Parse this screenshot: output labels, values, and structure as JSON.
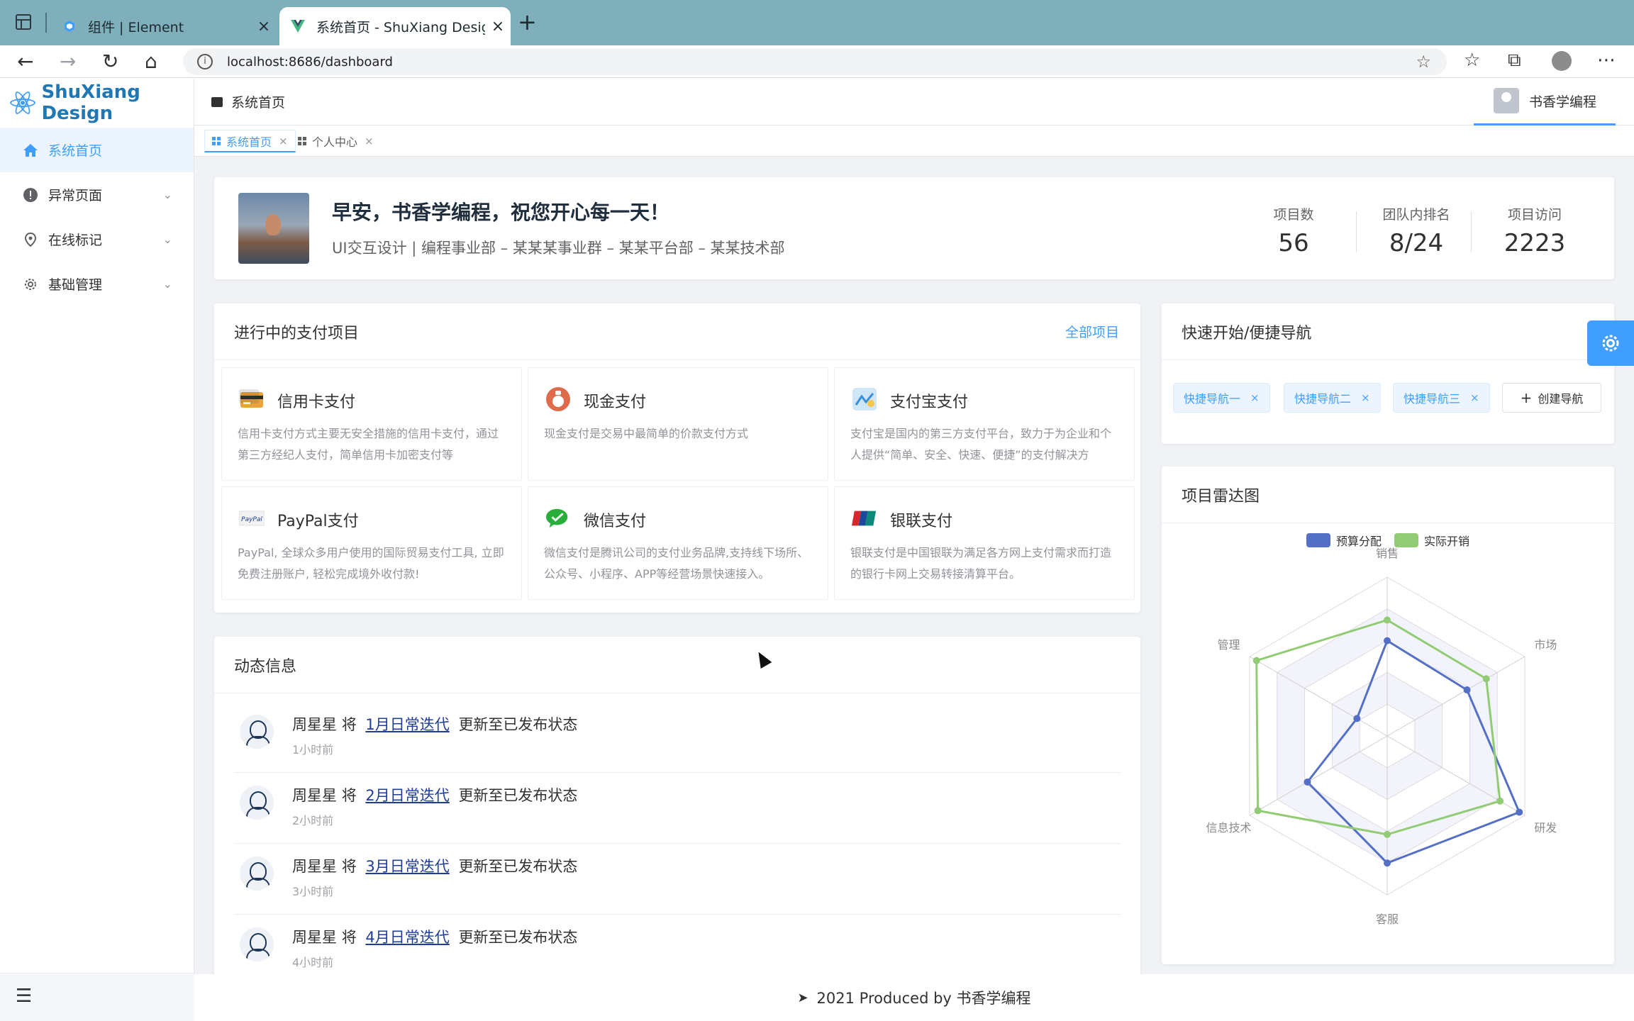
{
  "browser": {
    "tabs": [
      {
        "title": "组件 | Element",
        "icon": "element-favicon"
      },
      {
        "title": "系统首页 - ShuXiang Design",
        "icon": "vue-favicon"
      }
    ],
    "url": "localhost:8686/dashboard"
  },
  "app": {
    "logo_text": "ShuXiang Design",
    "menu": [
      {
        "label": "系统首页",
        "icon": "home-icon",
        "active": true
      },
      {
        "label": "异常页面",
        "icon": "warning-icon"
      },
      {
        "label": "在线标记",
        "icon": "location-icon"
      },
      {
        "label": "基础管理",
        "icon": "settings-icon"
      }
    ]
  },
  "header": {
    "breadcrumb": "系统首页",
    "user": "书香学编程"
  },
  "tags": [
    "系统首页",
    "个人中心"
  ],
  "welcome": {
    "greeting": "早安，书香学编程，祝您开心每一天！",
    "subtitle": "UI交互设计 | 编程事业部 – 某某某事业群 – 某某平台部 – 某某技术部",
    "stats": [
      {
        "label": "项目数",
        "value": "56"
      },
      {
        "label": "团队内排名",
        "value": "8/24"
      },
      {
        "label": "项目访问",
        "value": "2223"
      }
    ]
  },
  "payments": {
    "title": "进行中的支付项目",
    "more": "全部项目",
    "items": [
      {
        "name": "信用卡支付",
        "desc": "信用卡支付方式主要无安全措施的信用卡支付，通过第三方经纪人支付，简单信用卡加密支付等",
        "icon": "credit-card-icon"
      },
      {
        "name": "现金支付",
        "desc": "现金支付是交易中最简单的价款支付方式",
        "icon": "cash-icon"
      },
      {
        "name": "支付宝支付",
        "desc": "支付宝是国内的第三方支付平台，致力于为企业和个人提供“简单、安全、快速、便捷”的支付解决方",
        "icon": "alipay-icon"
      },
      {
        "name": "PayPal支付",
        "desc": "PayPal, 全球众多用户使用的国际贸易支付工具, 立即免费注册账户, 轻松完成境外收付款!",
        "icon": "paypal-icon"
      },
      {
        "name": "微信支付",
        "desc": "微信支付是腾讯公司的支付业务品牌,支持线下场所、公众号、小程序、APP等经营场景快速接入。",
        "icon": "wechat-icon"
      },
      {
        "name": "银联支付",
        "desc": "银联支付是中国银联为满足各方网上支付需求而打造的银行卡网上交易转接清算平台。",
        "icon": "unionpay-icon"
      }
    ]
  },
  "feed": {
    "title": "动态信息",
    "items": [
      {
        "user": "周星星",
        "verb": "将",
        "link": "1月日常迭代",
        "rest": "更新至已发布状态",
        "time": "1小时前"
      },
      {
        "user": "周星星",
        "verb": "将",
        "link": "2月日常迭代",
        "rest": "更新至已发布状态",
        "time": "2小时前"
      },
      {
        "user": "周星星",
        "verb": "将",
        "link": "3月日常迭代",
        "rest": "更新至已发布状态",
        "time": "3小时前"
      },
      {
        "user": "周星星",
        "verb": "将",
        "link": "4月日常迭代",
        "rest": "更新至已发布状态",
        "time": "4小时前"
      }
    ]
  },
  "quick": {
    "title": "快速开始/便捷导航",
    "tags": [
      "快捷导航一",
      "快捷导航二",
      "快捷导航三"
    ],
    "create": "创建导航"
  },
  "radar": {
    "title": "项目雷达图"
  },
  "chart_data": {
    "type": "radar",
    "indicators": [
      "销售",
      "市场",
      "研发",
      "客服",
      "信息技术",
      "管理"
    ],
    "max": 100,
    "series": [
      {
        "name": "预算分配",
        "color": "#5470c6",
        "values": [
          60,
          58,
          96,
          80,
          58,
          22
        ]
      },
      {
        "name": "实际开销",
        "color": "#91cc75",
        "values": [
          73,
          72,
          82,
          62,
          94,
          95
        ]
      }
    ]
  },
  "footer": {
    "text": "2021 Produced by 书香学编程"
  },
  "colors": {
    "primary": "#409eff",
    "series1": "#5470c6",
    "series2": "#91cc75"
  }
}
